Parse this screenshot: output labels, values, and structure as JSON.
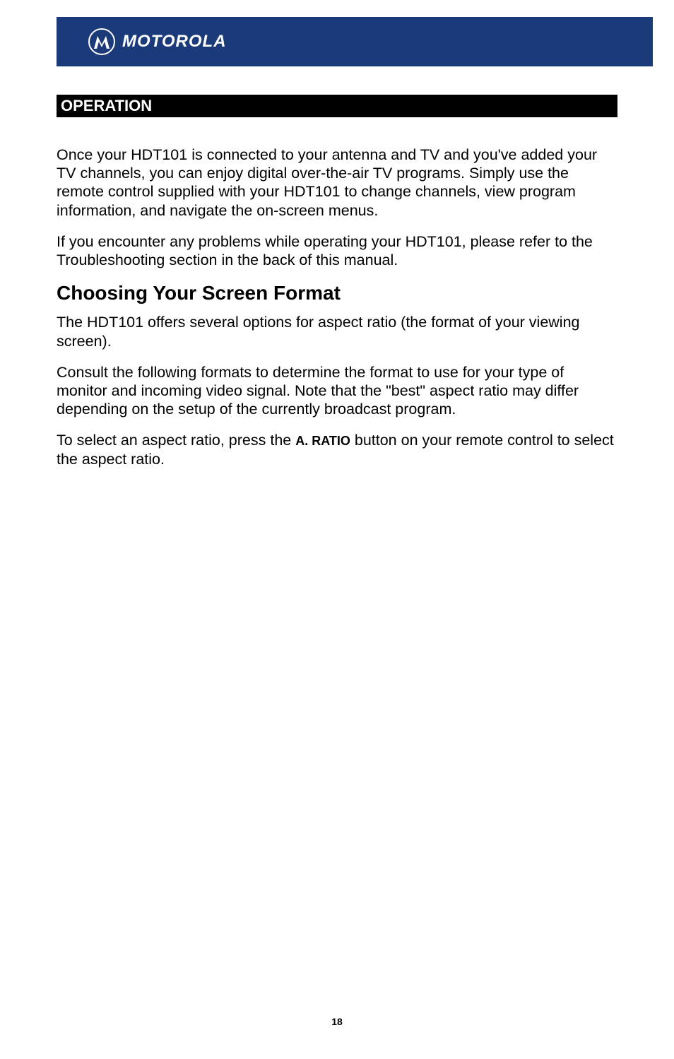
{
  "header": {
    "brand": "MOTOROLA"
  },
  "section": {
    "title": "OPERATION"
  },
  "paragraphs": {
    "p1": "Once your HDT101 is connected to your antenna and TV and you've added your TV channels, you can enjoy digital over-the-air TV programs. Simply use the remote control supplied with your HDT101 to change channels, view program information, and navigate the on-screen menus.",
    "p2": "If you encounter any problems while operating your HDT101, please refer to the Troubleshooting section in the back of this manual.",
    "heading": "Choosing Your Screen Format",
    "p3": "The HDT101 offers several options for aspect ratio (the format of your viewing screen).",
    "p4": "Consult the following formats to determine the format to use for your type of monitor and incoming video signal. Note that the \"best\" aspect ratio may differ depending on the setup of the currently broadcast program.",
    "p5_pre": "To select an aspect ratio, press the ",
    "p5_button": "A. RATIO",
    "p5_post": " button on your remote control to select the aspect ratio."
  },
  "page_number": "18"
}
